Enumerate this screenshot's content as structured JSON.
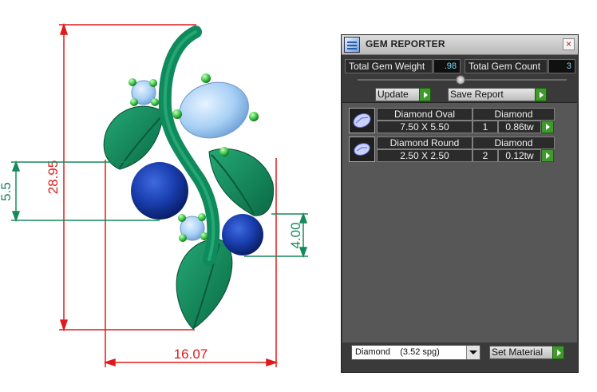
{
  "dimensions": {
    "height_total": "28.95",
    "left_offset": "5.5",
    "right_offset": "4.00",
    "width_total": "16.07"
  },
  "colors": {
    "dimension_red": "#e01a1a",
    "dimension_green": "#168a5a",
    "leaf_green": "#0f8a5c",
    "sapphire_blue": "#1a3fb0",
    "diamond_light_blue": "#a8d0f5",
    "accent_green_button": "#3f9a2c"
  },
  "reporter": {
    "title": "GEM REPORTER",
    "close_label": "×",
    "total_weight_label": "Total Gem Weight",
    "total_weight_value": ".98",
    "total_count_label": "Total Gem Count",
    "total_count_value": "3",
    "update_label": "Update",
    "save_report_label": "Save Report",
    "gems": [
      {
        "name": "Diamond Oval",
        "material": "Diamond",
        "size": "7.50 X 5.50",
        "count": "1",
        "weight": "0.86tw",
        "icon": "oval-gem-icon"
      },
      {
        "name": "Diamond Round",
        "material": "Diamond",
        "size": "2.50 X 2.50",
        "count": "2",
        "weight": "0.12tw",
        "icon": "round-gem-icon"
      }
    ],
    "material_select_value": "Diamond    (3.52 spg)",
    "set_material_label": "Set Material"
  }
}
